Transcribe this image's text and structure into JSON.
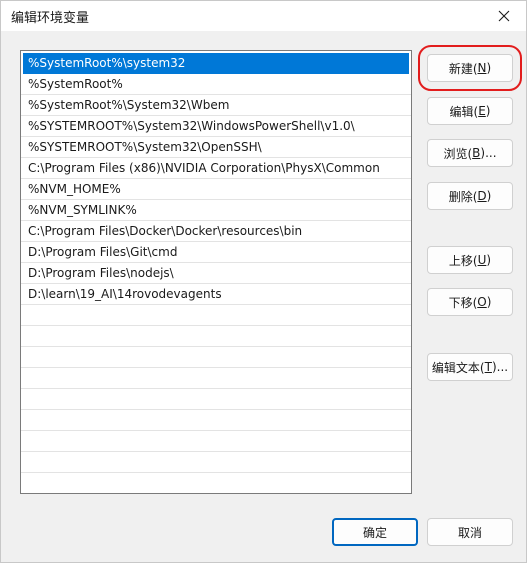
{
  "window": {
    "title": "编辑环境变量"
  },
  "list": {
    "items": [
      "%SystemRoot%\\system32",
      "%SystemRoot%",
      "%SystemRoot%\\System32\\Wbem",
      "%SYSTEMROOT%\\System32\\WindowsPowerShell\\v1.0\\",
      "%SYSTEMROOT%\\System32\\OpenSSH\\",
      "C:\\Program Files (x86)\\NVIDIA Corporation\\PhysX\\Common",
      "%NVM_HOME%",
      "%NVM_SYMLINK%",
      "C:\\Program Files\\Docker\\Docker\\resources\\bin",
      "D:\\Program Files\\Git\\cmd",
      "D:\\Program Files\\nodejs\\",
      "D:\\learn\\19_AI\\14rovodevagents"
    ],
    "selected_index": 0
  },
  "buttons": {
    "new": {
      "label": "新建(",
      "key": "N",
      "end": ")"
    },
    "edit": {
      "label": "编辑(",
      "key": "E",
      "end": ")"
    },
    "browse": {
      "label": "浏览(",
      "key": "B",
      "end": ")..."
    },
    "delete": {
      "label": "删除(",
      "key": "D",
      "end": ")"
    },
    "move_up": {
      "label": "上移(",
      "key": "U",
      "end": ")"
    },
    "move_down": {
      "label": "下移(",
      "key": "O",
      "end": ")"
    },
    "edit_text": {
      "label": "编辑文本(",
      "key": "T",
      "end": ")..."
    },
    "ok": {
      "label": "确定"
    },
    "cancel": {
      "label": "取消"
    }
  },
  "colors": {
    "selection": "#0078d7",
    "highlight_frame": "#e21c1c",
    "primary_border": "#0067c0"
  }
}
